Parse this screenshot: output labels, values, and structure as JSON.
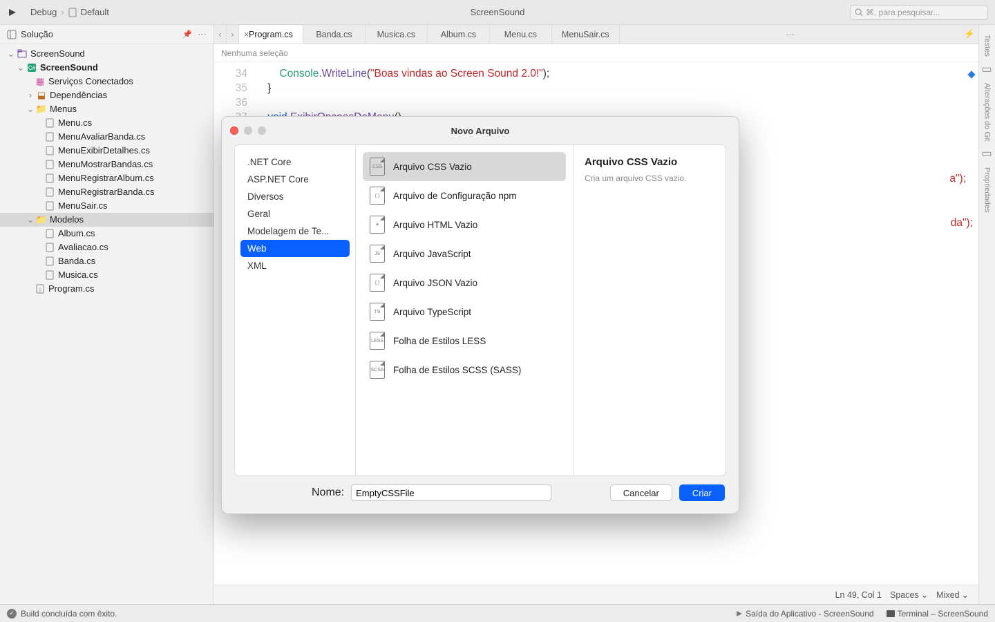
{
  "toolbar": {
    "config": "Debug",
    "target": "Default",
    "title": "ScreenSound",
    "search_placeholder": "⌘. para pesquisar..."
  },
  "sidebar": {
    "title": "Solução",
    "tree": {
      "solution": "ScreenSound",
      "project": "ScreenSound",
      "connected_services": "Serviços Conectados",
      "dependencies": "Dependências",
      "folder_menus": "Menus",
      "menus": [
        "Menu.cs",
        "MenuAvaliarBanda.cs",
        "MenuExibirDetalhes.cs",
        "MenuMostrarBandas.cs",
        "MenuRegistrarAlbum.cs",
        "MenuRegistrarBanda.cs",
        "MenuSair.cs"
      ],
      "folder_modelos": "Modelos",
      "modelos": [
        "Album.cs",
        "Avaliacao.cs",
        "Banda.cs",
        "Musica.cs"
      ],
      "program": "Program.cs"
    }
  },
  "tabs": [
    "Program.cs",
    "Banda.cs",
    "Musica.cs",
    "Album.cs",
    "Menu.cs",
    "MenuSair.cs"
  ],
  "breadcrumb": "Nenhuma seleção",
  "code": {
    "l34_console": "Console",
    "l34_write": ".WriteLine",
    "l34_open": "(",
    "l34_str": "\"Boas vindas ao Screen Sound 2.0!\"",
    "l34_close": ");",
    "l35": "    }",
    "l37_void": "    void",
    "l37_fn": " ExibirOpcoesDoMenu",
    "l37_paren": "()",
    "l_ghost1_tail": "a\");",
    "l_ghost2_tail": "da\");"
  },
  "editor_status": {
    "pos": "Ln 49, Col 1",
    "indent": "Spaces",
    "enc": "Mixed"
  },
  "right_rail": [
    "Testes",
    "Alterações do Git",
    "Propriedades"
  ],
  "statusbar": {
    "build": "Build concluída com êxito.",
    "panel1": "Saída do Aplicativo - ScreenSound",
    "panel2": "Terminal – ScreenSound"
  },
  "modal": {
    "title": "Novo Arquivo",
    "categories": [
      ".NET Core",
      "ASP.NET Core",
      "Diversos",
      "Geral",
      "Modelagem de Te...",
      "Web",
      "XML"
    ],
    "selected_category": 5,
    "templates": [
      {
        "label": "Arquivo CSS Vazio",
        "tag": "CSS"
      },
      {
        "label": "Arquivo de Configuração npm",
        "tag": "{ }"
      },
      {
        "label": "Arquivo HTML Vazio",
        "tag": "✦"
      },
      {
        "label": "Arquivo JavaScript",
        "tag": "JS"
      },
      {
        "label": "Arquivo JSON Vazio",
        "tag": "{ }"
      },
      {
        "label": "Arquivo TypeScript",
        "tag": "TS"
      },
      {
        "label": "Folha de Estilos LESS",
        "tag": "LESS"
      },
      {
        "label": "Folha de Estilos SCSS (SASS)",
        "tag": "SCSS"
      }
    ],
    "selected_template": 0,
    "desc_title": "Arquivo CSS Vazio",
    "desc_body": "Cria um arquivo CSS vazio.",
    "name_label": "Nome:",
    "name_value": "EmptyCSSFile",
    "cancel": "Cancelar",
    "create": "Criar"
  }
}
